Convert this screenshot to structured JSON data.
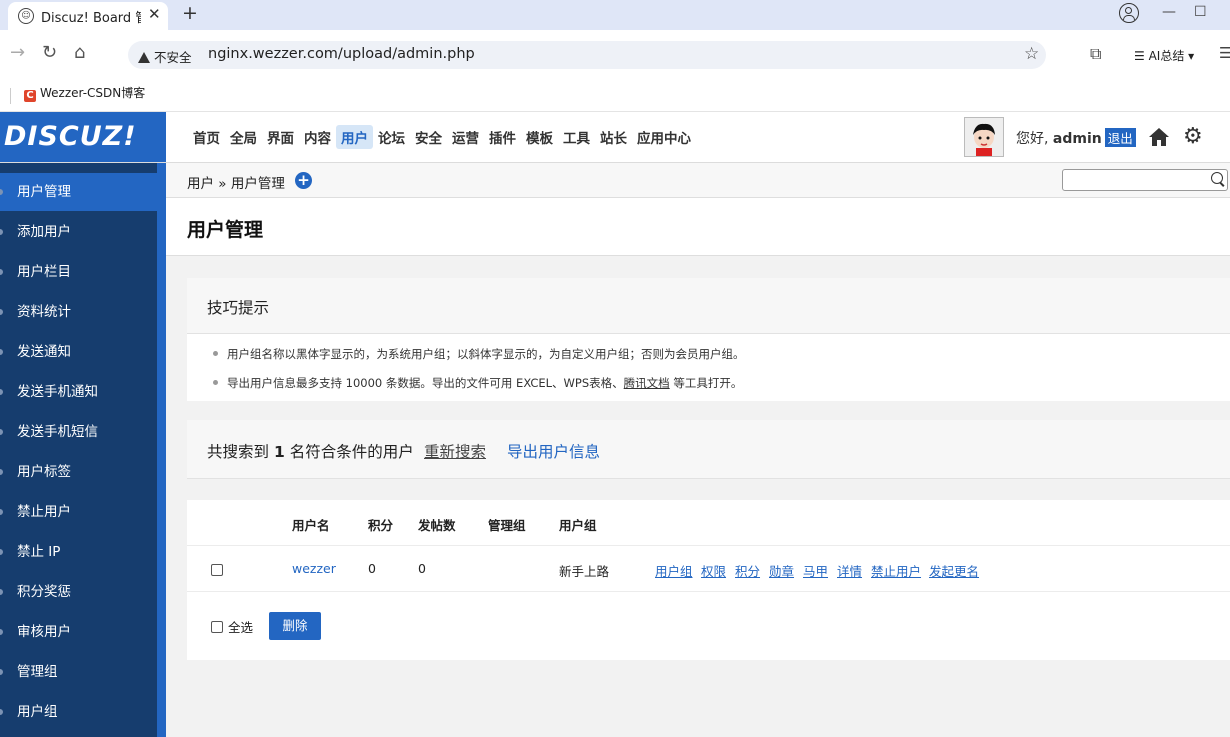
{
  "browser": {
    "tab_title": "Discuz! Board 管理",
    "url_warning": "不安全",
    "url": "nginx.wezzer.com/upload/admin.php",
    "ai_summary": "AI总结",
    "bookmark": "Wezzer-CSDN博客"
  },
  "header": {
    "logo": "DISCUZ!",
    "nav": [
      "首页",
      "全局",
      "界面",
      "内容",
      "用户",
      "论坛",
      "安全",
      "运营",
      "插件",
      "模板",
      "工具",
      "站长",
      "应用中心"
    ],
    "active_nav": "用户",
    "greeting": "您好,",
    "username": "admin",
    "logout": "退出"
  },
  "sidebar": {
    "items": [
      "用户管理",
      "添加用户",
      "用户栏目",
      "资料统计",
      "发送通知",
      "发送手机通知",
      "发送手机短信",
      "用户标签",
      "禁止用户",
      "禁止 IP",
      "积分奖惩",
      "审核用户",
      "管理组",
      "用户组"
    ],
    "active": "用户管理"
  },
  "breadcrumb": {
    "root": "用户",
    "sep": "»",
    "current": "用户管理"
  },
  "page": {
    "title": "用户管理"
  },
  "tips": {
    "title": "技巧提示",
    "line1": "用户组名称以黑体字显示的，为系统用户组；以斜体字显示的，为自定义用户组；否则为会员用户组。",
    "line2_a": "导出用户信息最多支持 10000 条数据。导出的文件可用 EXCEL、WPS表格、",
    "line2_link": "腾讯文档",
    "line2_b": " 等工具打开。"
  },
  "result": {
    "prefix": "共搜索到",
    "count": "1",
    "suffix": "名符合条件的用户",
    "re_search": "重新搜索",
    "export": "导出用户信息"
  },
  "table": {
    "headers": {
      "username": "用户名",
      "credits": "积分",
      "posts": "发帖数",
      "admingroup": "管理组",
      "usergroup": "用户组"
    },
    "rows": [
      {
        "username": "wezzer",
        "credits": "0",
        "posts": "0",
        "admingroup": "",
        "usergroup": "新手上路",
        "actions": [
          "用户组",
          "权限",
          "积分",
          "勋章",
          "马甲",
          "详情",
          "禁止用户",
          "发起更名"
        ]
      }
    ],
    "select_all": "全选",
    "delete": "删除"
  }
}
